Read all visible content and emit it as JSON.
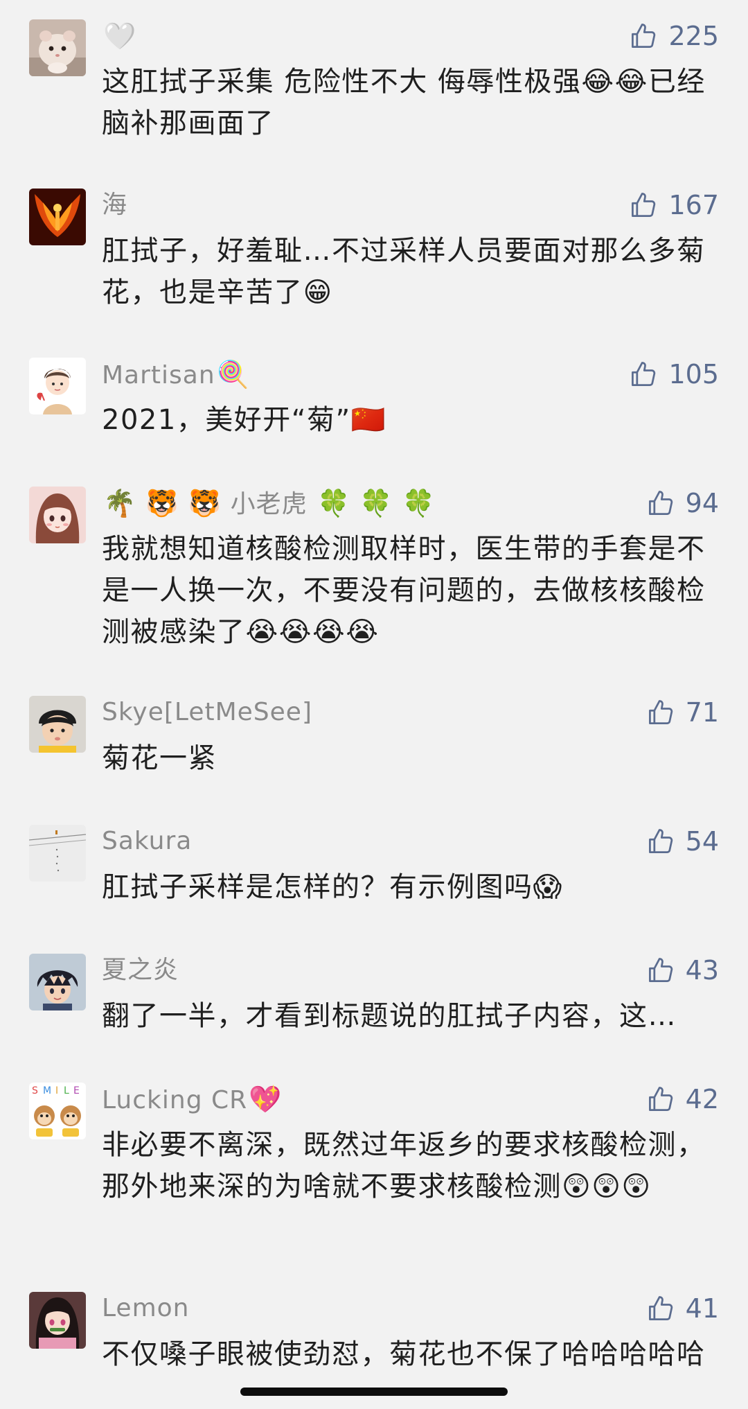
{
  "comments": [
    {
      "name": "",
      "name_emoji": "🤍",
      "likes": "225",
      "text": "这肛拭子采集 危险性不大 侮辱性极强😂😂已经脑补那画面了"
    },
    {
      "name": "海",
      "name_emoji": "",
      "likes": "167",
      "text": "肛拭子，好羞耻…不过采样人员要面对那么多菊花，也是辛苦了😁"
    },
    {
      "name": "Martisan",
      "name_emoji": "🍭",
      "likes": "105",
      "text": "2021，美好开“菊”🇨🇳"
    },
    {
      "name_prefix": "🌴 🐯 🐯",
      "name": "小老虎",
      "name_emoji": "🍀 🍀 🍀",
      "likes": "94",
      "text": "我就想知道核酸检测取样时，医生带的手套是不是一人换一次，不要没有问题的，去做核核酸检测被感染了😭😭😭😭"
    },
    {
      "name": "Skye[LetMeSee]",
      "name_emoji": "",
      "likes": "71",
      "text": "菊花一紧"
    },
    {
      "name": "Sakura",
      "name_emoji": "",
      "likes": "54",
      "text": "肛拭子采样是怎样的？有示例图吗😱"
    },
    {
      "name": "夏之炎",
      "name_emoji": "",
      "likes": "43",
      "text": "翻了一半，才看到标题说的肛拭子内容，这…"
    },
    {
      "name": "Lucking CR",
      "name_emoji": "💖",
      "likes": "42",
      "text": "非必要不离深，既然过年返乡的要求核酸检测，那外地来深的为啥就不要求核酸检测😲😲😲"
    },
    {
      "name": "Lemon",
      "name_emoji": "",
      "likes": "41",
      "text": "不仅嗓子眼被使劲怼，菊花也不保了哈哈哈哈哈"
    }
  ],
  "colors": {
    "background": "#f2f2f2",
    "name": "#8a8a8a",
    "likes": "#5b6c8f",
    "text": "#1f1f1f"
  }
}
